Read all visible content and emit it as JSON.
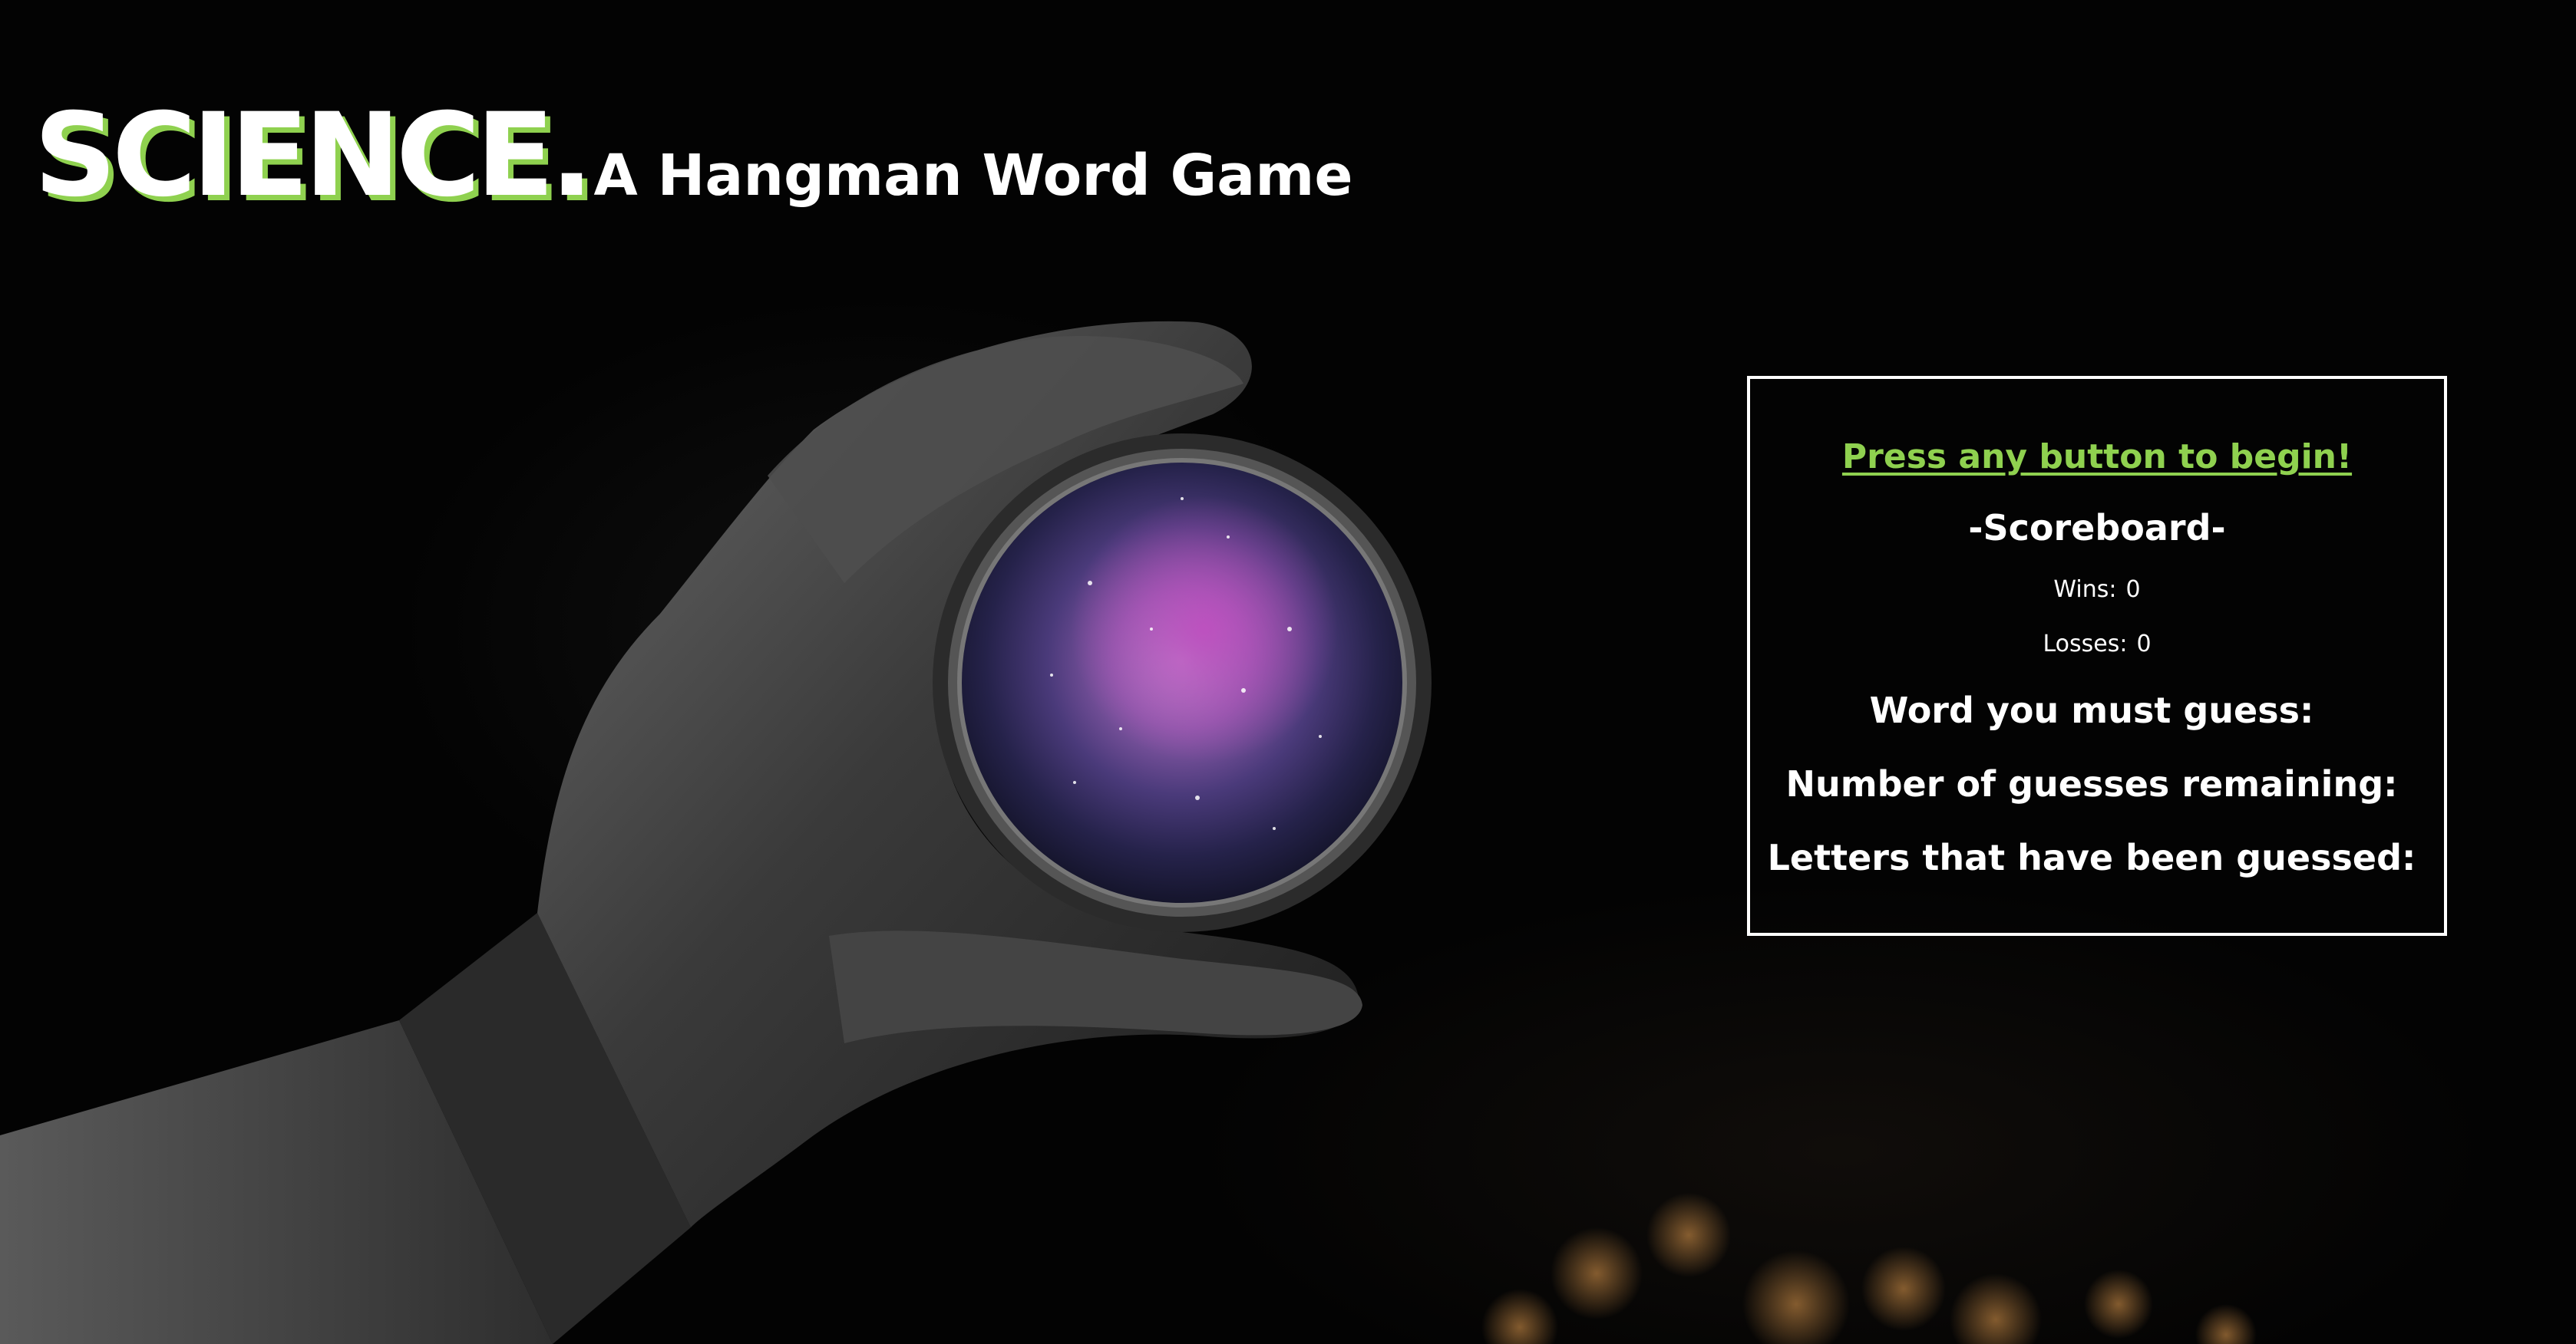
{
  "header": {
    "brand": "SCIENCE.",
    "subtitle": "A Hangman Word Game"
  },
  "colors": {
    "accent": "#8fd14f",
    "text": "#ffffff",
    "background": "#030303"
  },
  "hero": {
    "description_icon": "gloved-hand-holding-galaxy-lens"
  },
  "panel": {
    "start_prompt": "Press any button to begin!",
    "scoreboard_title": "-Scoreboard-",
    "wins_label": "Wins:",
    "wins_value": "0",
    "losses_label": "Losses:",
    "losses_value": "0",
    "word_label": "Word you must guess:",
    "word_value": "",
    "guesses_label": "Number of guesses remaining:",
    "guesses_value": "",
    "letters_label": "Letters that have been guessed:",
    "letters_value": ""
  }
}
